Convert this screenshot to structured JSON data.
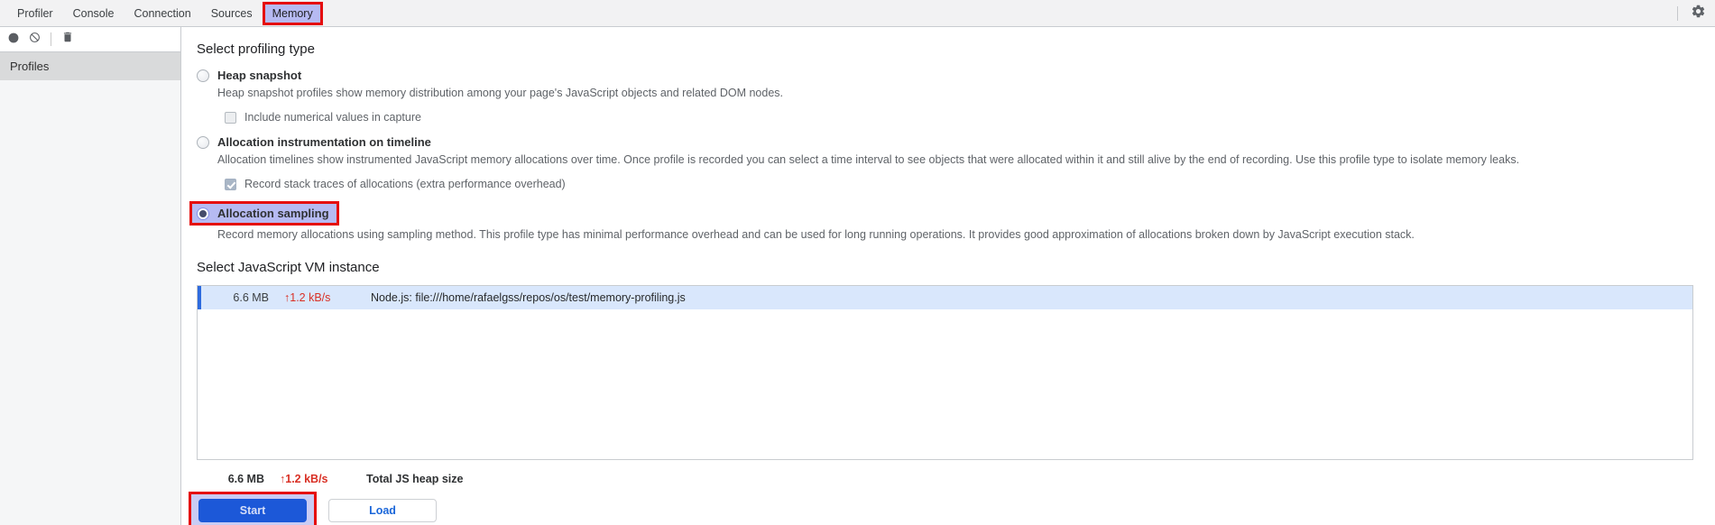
{
  "tab_bar": {
    "tabs": [
      {
        "label": "Profiler",
        "active": false
      },
      {
        "label": "Console",
        "active": false
      },
      {
        "label": "Connection",
        "active": false
      },
      {
        "label": "Sources",
        "active": false
      },
      {
        "label": "Memory",
        "active": true
      }
    ],
    "settings_icon": "gear-icon"
  },
  "toolbar": {
    "icons": [
      "record-circle-icon",
      "block-clear-icon",
      "trash-icon"
    ]
  },
  "sidebar": {
    "header": "Profiles"
  },
  "profiling": {
    "heading": "Select profiling type",
    "options": [
      {
        "label": "Heap snapshot",
        "selected": false,
        "description": "Heap snapshot profiles show memory distribution among your page's JavaScript objects and related DOM nodes.",
        "checkbox": {
          "label": "Include numerical values in capture",
          "checked": false
        }
      },
      {
        "label": "Allocation instrumentation on timeline",
        "selected": false,
        "description": "Allocation timelines show instrumented JavaScript memory allocations over time. Once profile is recorded you can select a time interval to see objects that were allocated within it and still alive by the end of recording. Use this profile type to isolate memory leaks.",
        "checkbox": {
          "label": "Record stack traces of allocations (extra performance overhead)",
          "checked": true,
          "disabled": true
        }
      },
      {
        "label": "Allocation sampling",
        "selected": true,
        "annotated": true,
        "description": "Record memory allocations using sampling method. This profile type has minimal performance overhead and can be used for long running operations. It provides good approximation of allocations broken down by JavaScript execution stack."
      }
    ]
  },
  "vm": {
    "heading": "Select JavaScript VM instance",
    "instances": [
      {
        "size": "6.6 MB",
        "rate": "↑1.2 kB/s",
        "name": "Node.js: file:///home/rafaelgss/repos/os/test/memory-profiling.js",
        "selected": true
      }
    ],
    "total": {
      "size": "6.6 MB",
      "rate": "↑1.2 kB/s",
      "label": "Total JS heap size"
    }
  },
  "actions": {
    "start": "Start",
    "load": "Load"
  },
  "colors": {
    "annotation_red": "#e50d0d",
    "highlight_lavender": "#b6baf2",
    "accent_blue": "#1c58d8",
    "selected_row_blue": "#d9e7fc",
    "row_border_blue": "#2e6bde",
    "rate_red": "#d93025",
    "sidebar_header_gray": "#d9dadb"
  }
}
